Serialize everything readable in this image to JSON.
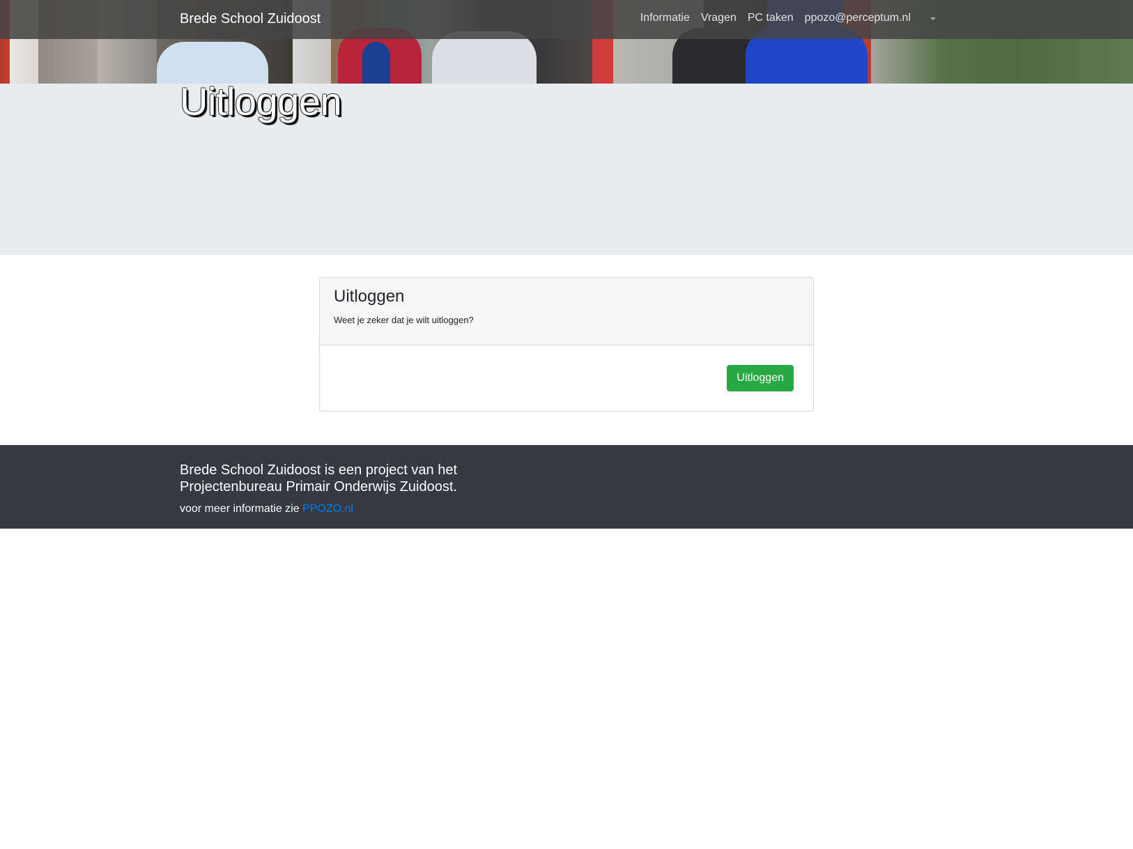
{
  "navbar": {
    "brand": "Brede School Zuidoost",
    "links": [
      "Informatie",
      "Vragen",
      "PC taken",
      "ppozo@perceptum.nl"
    ],
    "dropdown_icon": "caret-down-icon"
  },
  "jumbotron": {
    "title": "Uitloggen"
  },
  "card": {
    "title": "Uitloggen",
    "subtitle": "Weet je zeker dat je wilt uitloggen?",
    "button_label": "Uitloggen"
  },
  "footer": {
    "text": "Brede School Zuidoost is een project van het Projectenbureau Primair Onderwijs Zuidoost.",
    "more_prefix": "voor meer informatie zie",
    "link_label": "PPOZO.nl"
  },
  "colors": {
    "button": "#28a745",
    "footer_bg": "#343a40",
    "jumbotron_bg": "#e9ecef",
    "link": "#007bff"
  }
}
